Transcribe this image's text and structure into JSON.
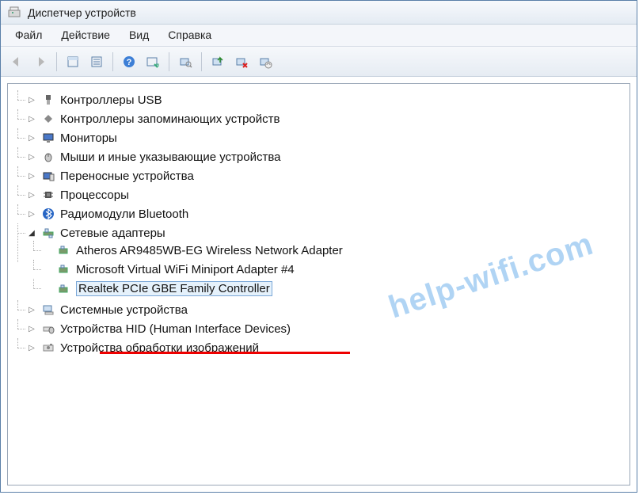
{
  "window": {
    "title": "Диспетчер устройств"
  },
  "menu": {
    "file": "Файл",
    "action": "Действие",
    "view": "Вид",
    "help": "Справка"
  },
  "tree": {
    "usb": "Контроллеры USB",
    "storage": "Контроллеры запоминающих устройств",
    "monitors": "Мониторы",
    "mice": "Мыши и иные указывающие устройства",
    "portable": "Переносные устройства",
    "cpu": "Процессоры",
    "bluetooth": "Радиомодули Bluetooth",
    "network": "Сетевые адаптеры",
    "net_atheros": "Atheros AR9485WB-EG Wireless Network Adapter",
    "net_msvirtual": "Microsoft Virtual WiFi Miniport Adapter #4",
    "net_realtek": "Realtek PCIe GBE Family Controller",
    "system": "Системные устройства",
    "hid": "Устройства HID (Human Interface Devices)",
    "imaging": "Устройства обработки изображений"
  },
  "watermark": "help-wifi.com"
}
